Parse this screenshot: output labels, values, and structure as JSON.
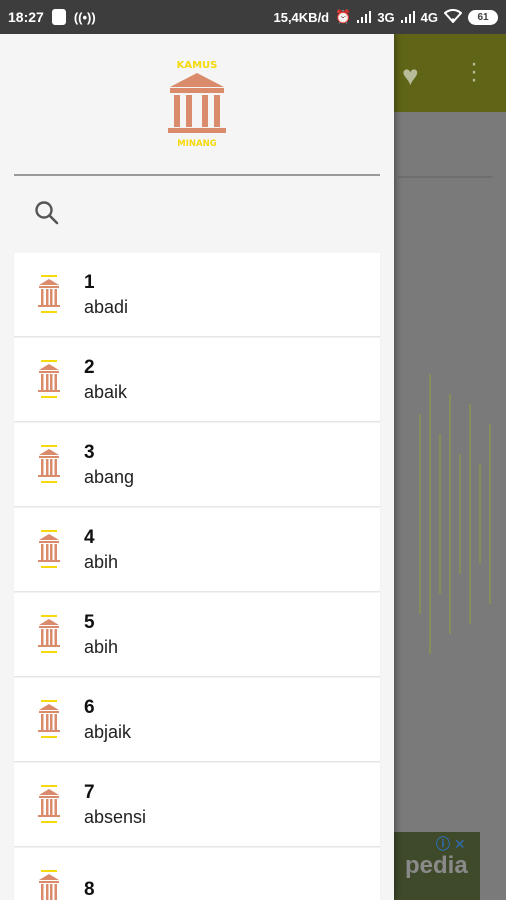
{
  "status_bar": {
    "time": "18:27",
    "speed": "15,4KB/d",
    "network_1": "3G",
    "network_2": "4G",
    "battery": "61"
  },
  "logo": {
    "top_text": "KAMUS",
    "bottom_text": "MINANG",
    "accent_color": "#f5d90a",
    "building_color": "#d98b6b"
  },
  "search": {
    "icon": "search-icon"
  },
  "entries": [
    {
      "number": "1",
      "word": "abadi"
    },
    {
      "number": "2",
      "word": "abaik"
    },
    {
      "number": "3",
      "word": "abang"
    },
    {
      "number": "4",
      "word": "abih"
    },
    {
      "number": "5",
      "word": "abih"
    },
    {
      "number": "6",
      "word": "abjaik"
    },
    {
      "number": "7",
      "word": "absensi"
    },
    {
      "number": "8",
      "word": ""
    }
  ],
  "background_app": {
    "toolbar_color": "#8c9417",
    "ad_text": "pedia"
  }
}
